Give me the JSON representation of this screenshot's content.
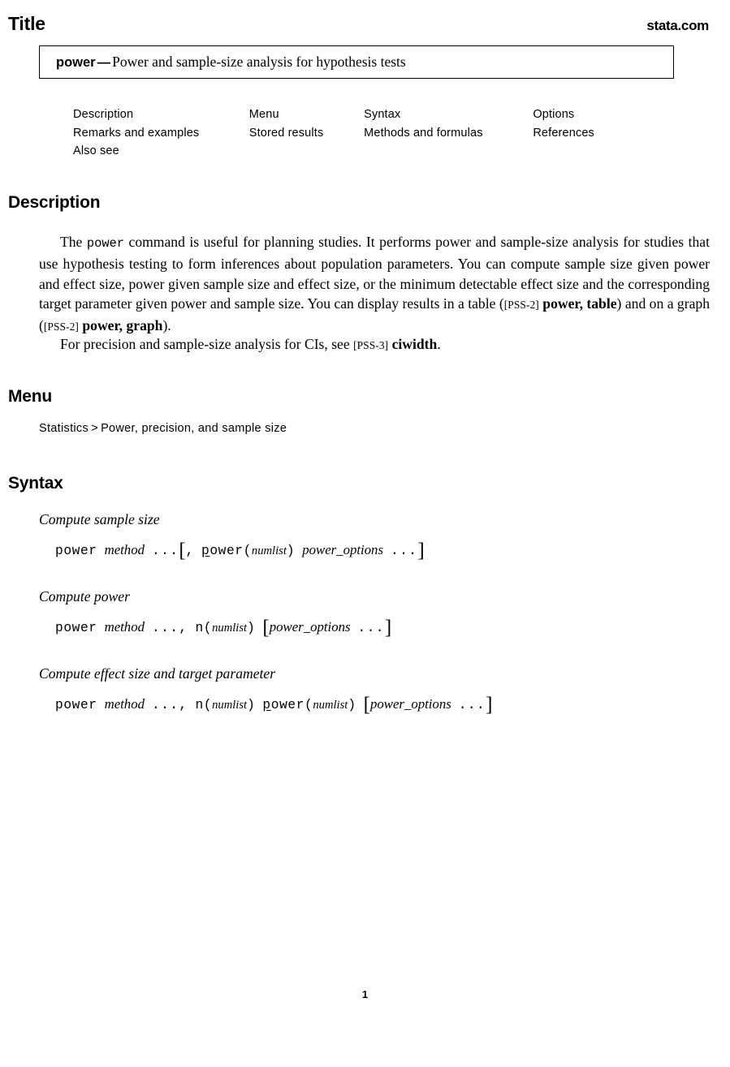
{
  "header": {
    "title": "Title",
    "site": "stata.com"
  },
  "title_box": {
    "command": "power",
    "dash": "—",
    "description": "Power and sample-size analysis for hypothesis tests"
  },
  "nav_links": {
    "rows": [
      [
        {
          "label": "Description"
        },
        {
          "label": "Menu"
        },
        {
          "label": "Syntax"
        },
        {
          "label": "Options"
        }
      ],
      [
        {
          "label": "Remarks and examples"
        },
        {
          "label": "Stored results"
        },
        {
          "label": "Methods and formulas"
        },
        {
          "label": "References"
        }
      ],
      [
        {
          "label": "Also see"
        },
        {
          "label": ""
        },
        {
          "label": ""
        },
        {
          "label": ""
        }
      ]
    ]
  },
  "sections": {
    "description": {
      "heading": "Description",
      "paragraph_1": {
        "t1": "The ",
        "cmd": "power",
        "t2": " command is useful for planning studies. It performs power and sample-size analysis for studies that use hypothesis testing to form inferences about population parameters. You can compute sample size given power and effect size, power given sample size and effect size, or the minimum detectable effect size and the corresponding target parameter given power and sample size. You can display results in a table (",
        "ref1_tag": "[PSS-2]",
        "ref1_cmd": "power, table",
        "t3": ") and on a graph (",
        "ref2_tag": "[PSS-2]",
        "ref2_cmd": "power, graph",
        "t4": ")."
      },
      "paragraph_2": {
        "t1": "For precision and sample-size analysis for CIs, see ",
        "ref_tag": "[PSS-3]",
        "ref_cmd": "ciwidth",
        "t2": "."
      }
    },
    "menu": {
      "heading": "Menu",
      "root": "Statistics",
      "separator": ">",
      "path": "Power, precision, and sample size"
    },
    "syntax": {
      "heading": "Syntax",
      "blocks": [
        {
          "label": "Compute sample size",
          "cmd": "power",
          "method": "method",
          "dots1": "...",
          "open_bracket": "[",
          "comma": ",",
          "opt_underline": "p",
          "opt_rest": "ower",
          "arg_open": "(",
          "arg": "numlist",
          "arg_close": ")",
          "options": "power_options",
          "dots2": "...",
          "close_bracket": "]"
        },
        {
          "label": "Compute power",
          "cmd": "power",
          "method": "method",
          "dots1": "...,",
          "n_opt": "n",
          "arg_open": "(",
          "arg": "numlist",
          "arg_close": ")",
          "open_bracket": "[",
          "options": "power_options",
          "dots2": "...",
          "close_bracket": "]"
        },
        {
          "label": "Compute effect size and target parameter",
          "cmd": "power",
          "method": "method",
          "dots1": "...,",
          "n_opt": "n",
          "arg_open": "(",
          "arg": "numlist",
          "arg_close": ")",
          "opt_underline": "p",
          "opt_rest": "ower",
          "arg2_open": "(",
          "arg2": "numlist",
          "arg2_close": ")",
          "open_bracket": "[",
          "options": "power_options",
          "dots2": "...",
          "close_bracket": "]"
        }
      ]
    }
  },
  "footer": {
    "page_number": "1"
  }
}
